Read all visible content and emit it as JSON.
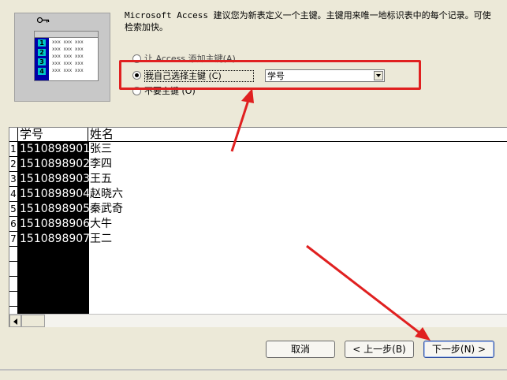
{
  "description_lines": [
    "Microsoft Access 建议您为新表定义一个主键。主键用来唯一地标识表中的每个记录。可使",
    "检索加快。"
  ],
  "illustration": {
    "key_numbers": [
      "1",
      "2",
      "3",
      "4",
      "4"
    ],
    "placeholder_text": "xxx xxx xxx"
  },
  "options": {
    "auto_key": "让 Access 添加主键(A)",
    "choose_key": "我自己选择主键 (C)",
    "no_key": "不要主键 (O)"
  },
  "combo_value": "学号",
  "grid": {
    "columns": [
      "学号",
      "姓名"
    ],
    "rows": [
      {
        "num": "1",
        "id": "1510898901",
        "name": "张三"
      },
      {
        "num": "2",
        "id": "1510898902",
        "name": "李四"
      },
      {
        "num": "3",
        "id": "1510898903",
        "name": "王五"
      },
      {
        "num": "4",
        "id": "1510898904",
        "name": "赵晓六"
      },
      {
        "num": "5",
        "id": "1510898905",
        "name": "秦武奇"
      },
      {
        "num": "6",
        "id": "1510898906",
        "name": "大牛"
      },
      {
        "num": "7",
        "id": "1510898907",
        "name": "王二"
      }
    ]
  },
  "buttons": {
    "cancel": "取消",
    "back": "< 上一步(B)",
    "next": "下一步(N) >"
  },
  "colors": {
    "highlight_red": "#e02020",
    "selection_black": "#000000",
    "dialog_bg": "#ece9d8"
  }
}
